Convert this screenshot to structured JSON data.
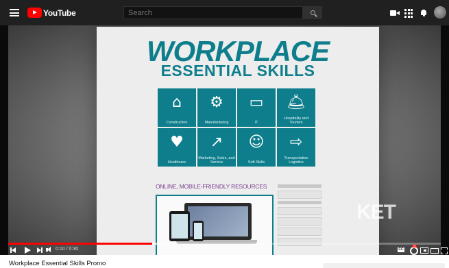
{
  "header": {
    "logo_text": "YouTube",
    "search_placeholder": "Search"
  },
  "video": {
    "poster": {
      "title_line1": "WORKPLACE",
      "title_line2": "ESSENTIAL SKILLS",
      "tiles": [
        {
          "label": "Construction",
          "icon": "house-icon",
          "glyph": "⌂"
        },
        {
          "label": "Manufacturing",
          "icon": "gear-wrench-icon",
          "glyph": "⚙"
        },
        {
          "label": "IT",
          "icon": "laptop-icon",
          "glyph": "▭"
        },
        {
          "label": "Hospitality and Tourism",
          "icon": "bellhop-icon",
          "glyph": "🛎"
        },
        {
          "label": "Healthcare",
          "icon": "heart-icon",
          "glyph": "♥"
        },
        {
          "label": "Marketing, Sales, and Service",
          "icon": "chart-icon",
          "glyph": "↗"
        },
        {
          "label": "Soft Skills",
          "icon": "people-chat-icon",
          "glyph": "☺"
        },
        {
          "label": "Transportation Logistics",
          "icon": "truck-icon",
          "glyph": "⇨"
        }
      ],
      "resources_heading": "ONLINE, MOBILE-FRIENDLY RESOURCES",
      "watermark": "KET"
    },
    "controls": {
      "time": "0:10 / 0:30",
      "progress_fraction": 0.333,
      "buffered_fraction": 0.36
    },
    "title": "Workplace Essential Skills Promo"
  },
  "colors": {
    "brand_teal": "#0e7e8c",
    "youtube_red": "#ff0000",
    "header_bg": "#202020"
  }
}
